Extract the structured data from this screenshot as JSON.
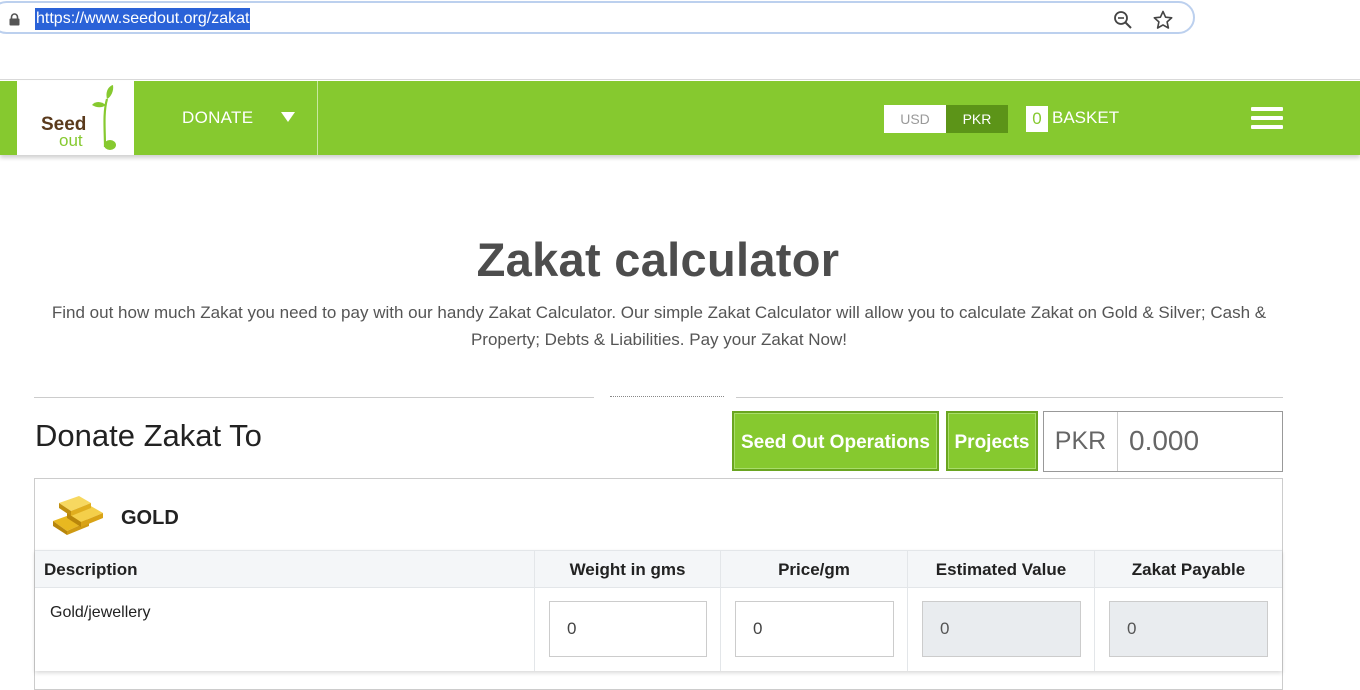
{
  "browser": {
    "url": "https://www.seedout.org/zakat"
  },
  "header": {
    "logo_seed": "Seed",
    "logo_out": "out",
    "donate_label": "DONATE",
    "currency_usd": "USD",
    "currency_pkr": "PKR",
    "selected_currency": "PKR",
    "basket_count": "0",
    "basket_label": "BASKET",
    "brand_color": "#86c92f"
  },
  "main": {
    "title": "Zakat calculator",
    "description": "Find out how much Zakat you need to pay with our handy Zakat Calculator. Our simple Zakat Calculator will allow you to calculate Zakat on Gold & Silver; Cash & Property; Debts & Liabilities. Pay your Zakat Now!",
    "donate_title": "Donate Zakat To",
    "btn_operations": "Seed Out Operations",
    "btn_projects": "Projects",
    "amount_currency": "PKR",
    "amount_value": "0.000"
  },
  "gold": {
    "title": "GOLD",
    "headers": {
      "description": "Description",
      "weight": "Weight in gms",
      "price": "Price/gm",
      "estimated": "Estimated Value",
      "zakat": "Zakat Payable"
    },
    "row": {
      "description": "Gold/jewellery",
      "weight": "0",
      "price": "0",
      "estimated": "0",
      "zakat": "0"
    }
  }
}
